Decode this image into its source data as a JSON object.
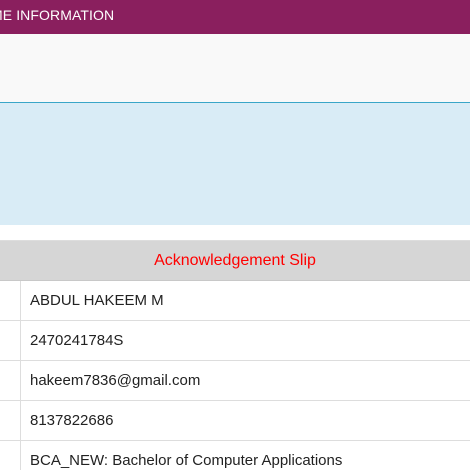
{
  "header": {
    "title": "ME INFORMATION",
    "background_color": "#8a1f5e"
  },
  "slip": {
    "title": "Acknowledgement Slip",
    "title_color": "#ff0000",
    "rows": [
      {
        "value": "ABDUL HAKEEM M"
      },
      {
        "value": "2470241784S"
      },
      {
        "value": "hakeem7836@gmail.com"
      },
      {
        "value": "8137822686"
      },
      {
        "value": "BCA_NEW: Bachelor of Computer Applications"
      }
    ]
  }
}
